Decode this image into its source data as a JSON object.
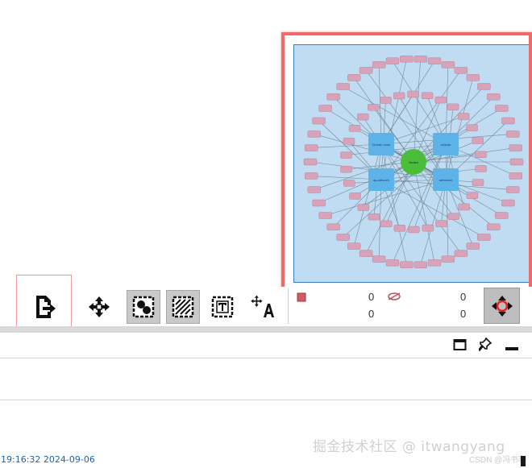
{
  "toolbar": {
    "tools": [
      {
        "name": "export-button",
        "icon": "export-icon",
        "active": false
      },
      {
        "name": "fit-network-button",
        "icon": "move-arrows-icon",
        "active": false
      },
      {
        "name": "show-selected-nodes-button",
        "icon": "selected-nodes-icon",
        "active": true
      },
      {
        "name": "hide-selected-button",
        "icon": "hatched-box-icon",
        "active": true
      },
      {
        "name": "text-annotation-button",
        "icon": "text-box-icon",
        "active": false
      },
      {
        "name": "font-size-button",
        "icon": "font-resize-icon",
        "active": false
      }
    ],
    "stats": {
      "selected_nodes": "0",
      "total_nodes": "0",
      "selected_edges": "0",
      "total_edges": "0"
    }
  },
  "overview": {
    "center_label": "Nodes",
    "hubs": [
      "Cluster node",
      "cellular",
      "ap-network",
      "adhesion"
    ]
  },
  "panel": {
    "window_controls": [
      "maximize-icon",
      "pin-icon",
      "minimize-icon"
    ]
  },
  "footer": {
    "timestamp": "19:16:32 2024-09-06",
    "watermark": "掘金技术社区 @ itwangyang",
    "watermark_sub": "CSDN @冯书和"
  },
  "colors": {
    "node_fill": "#d8a3b8",
    "center_node": "#4cbd3a",
    "hub_node": "#5db3e8",
    "edge": "#6c7a86",
    "overview_bg": "#bfdcf2",
    "highlight_red": "#f06a6a"
  }
}
